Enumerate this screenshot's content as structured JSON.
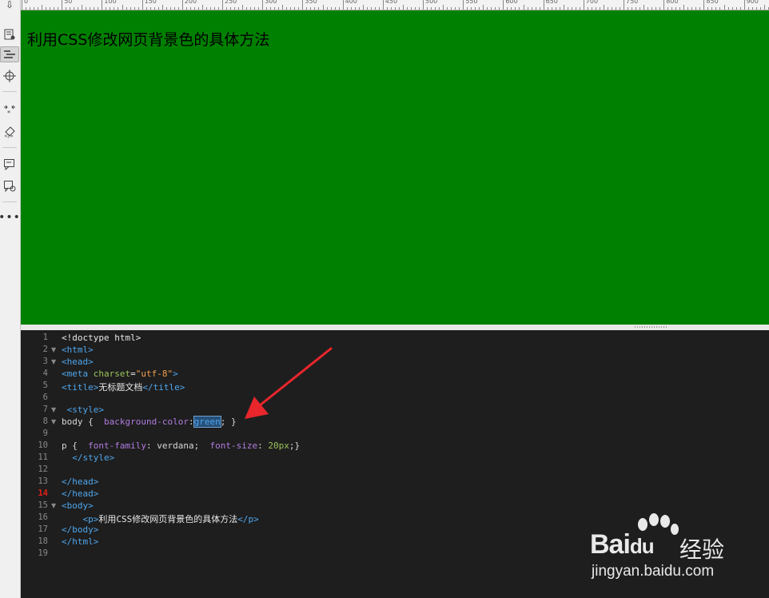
{
  "ruler": {
    "labels": [
      "0",
      "50",
      "100",
      "150",
      "200",
      "250",
      "300",
      "350",
      "400",
      "450",
      "500",
      "550",
      "600",
      "650",
      "700",
      "750",
      "800",
      "850",
      "900"
    ]
  },
  "preview": {
    "text": "利用CSS修改网页背景色的具体方法",
    "background": "#008000"
  },
  "editor": {
    "current_line": 14,
    "lines": [
      {
        "n": "1",
        "fold": false,
        "tokens": [
          [
            "tx",
            "<!doctype html>"
          ]
        ]
      },
      {
        "n": "2",
        "fold": true,
        "tokens": [
          [
            "tg",
            "<html>"
          ]
        ]
      },
      {
        "n": "3",
        "fold": true,
        "tokens": [
          [
            "tg",
            "<head>"
          ]
        ]
      },
      {
        "n": "4",
        "fold": false,
        "tokens": [
          [
            "tg",
            "<meta "
          ],
          [
            "at",
            "charset"
          ],
          [
            "tx",
            "="
          ],
          [
            "st",
            "\"utf-8\""
          ],
          [
            "tg",
            ">"
          ]
        ]
      },
      {
        "n": "5",
        "fold": false,
        "tokens": [
          [
            "tg",
            "<title>"
          ],
          [
            "tx",
            "无标题文档"
          ],
          [
            "tg",
            "</title>"
          ]
        ]
      },
      {
        "n": "6",
        "fold": false,
        "tokens": []
      },
      {
        "n": "7",
        "fold": true,
        "tokens": [
          [
            "tx",
            " "
          ],
          [
            "tg",
            "<style>"
          ]
        ]
      },
      {
        "n": "8",
        "fold": true,
        "tokens": [
          [
            "ky",
            "body { "
          ],
          [
            "tx",
            " "
          ],
          [
            "pr",
            "background-color"
          ],
          [
            "ky",
            ":"
          ],
          [
            "sel",
            "green"
          ],
          [
            "ky",
            "; }"
          ]
        ]
      },
      {
        "n": "9",
        "fold": false,
        "tokens": []
      },
      {
        "n": "10",
        "fold": false,
        "tokens": [
          [
            "ky",
            "p { "
          ],
          [
            "tx",
            " "
          ],
          [
            "pr",
            "font-family"
          ],
          [
            "ky",
            ": verdana;  "
          ],
          [
            "pr",
            "font-size"
          ],
          [
            "ky",
            ": "
          ],
          [
            "nm",
            "20px"
          ],
          [
            "ky",
            ";}"
          ]
        ]
      },
      {
        "n": "11",
        "fold": false,
        "tokens": [
          [
            "tx",
            "  "
          ],
          [
            "tg",
            "</style>"
          ]
        ]
      },
      {
        "n": "12",
        "fold": false,
        "tokens": []
      },
      {
        "n": "13",
        "fold": false,
        "tokens": [
          [
            "tg",
            "</head>"
          ]
        ]
      },
      {
        "n": "14",
        "fold": false,
        "tokens": [
          [
            "tg",
            "</head>"
          ]
        ]
      },
      {
        "n": "15",
        "fold": true,
        "tokens": [
          [
            "tg",
            "<body>"
          ]
        ]
      },
      {
        "n": "16",
        "fold": false,
        "tokens": [
          [
            "tx",
            "    "
          ],
          [
            "tg",
            "<p>"
          ],
          [
            "tx",
            "利用CSS修改网页背景色的具体方法"
          ],
          [
            "tg",
            "</p>"
          ]
        ]
      },
      {
        "n": "17",
        "fold": false,
        "tokens": [
          [
            "tg",
            "</body>"
          ]
        ]
      },
      {
        "n": "18",
        "fold": false,
        "tokens": [
          [
            "tg",
            "</html>"
          ]
        ]
      },
      {
        "n": "19",
        "fold": false,
        "tokens": []
      }
    ]
  },
  "watermark": {
    "logo": "Bai",
    "logo2": "du",
    "jingyan": "经验",
    "url": "jingyan.baidu.com"
  },
  "tools": [
    {
      "icon": "insert-icon"
    },
    {
      "icon": "file-properties-icon"
    },
    {
      "icon": "code-format-icon"
    },
    {
      "icon": "target-icon"
    },
    {
      "icon": "expand-icon"
    },
    {
      "icon": "validate-icon"
    },
    {
      "icon": "comment-icon"
    },
    {
      "icon": "comment-settings-icon"
    },
    {
      "icon": "more-icon"
    }
  ]
}
